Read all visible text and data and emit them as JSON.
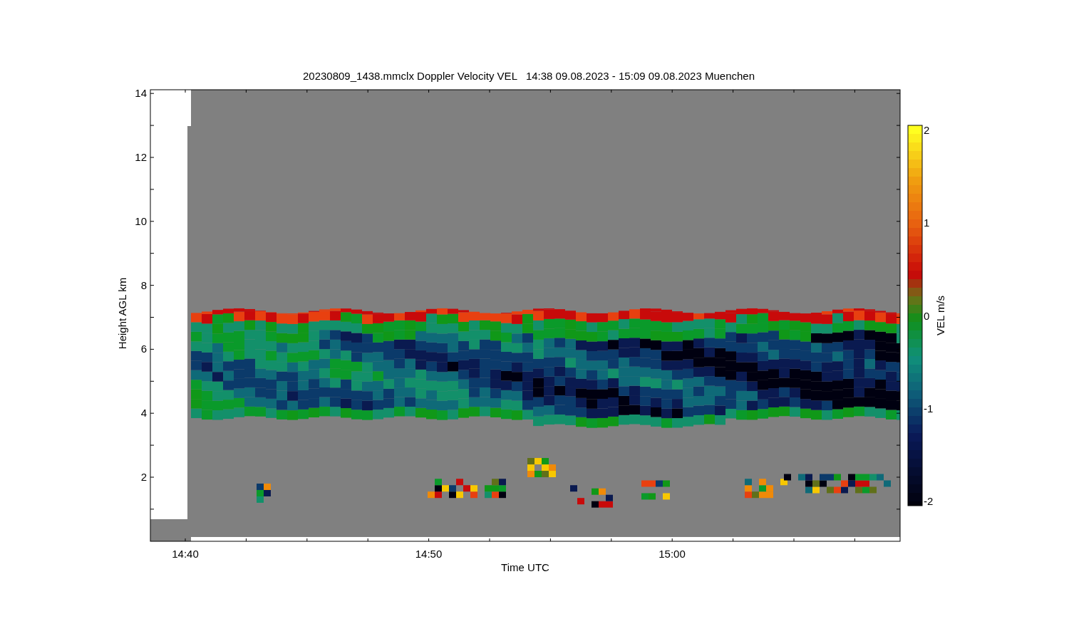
{
  "plot": {
    "title": "20230809_1438.mmclx Doppler Velocity VEL   14:38 09.08.2023 - 15:09 09.08.2023 Muenchen",
    "y_axis": {
      "label": "Height AGL km",
      "ticks": [
        "14",
        "12",
        "10",
        "8",
        "6",
        "4",
        "2"
      ]
    },
    "x_axis": {
      "label": "Time UTC",
      "ticks": [
        "14:40",
        "14:50",
        "15:00"
      ]
    },
    "colorbar": {
      "label": "VEL m/s",
      "ticks": [
        "2",
        "1",
        "0",
        "-1",
        "-2"
      ]
    }
  }
}
